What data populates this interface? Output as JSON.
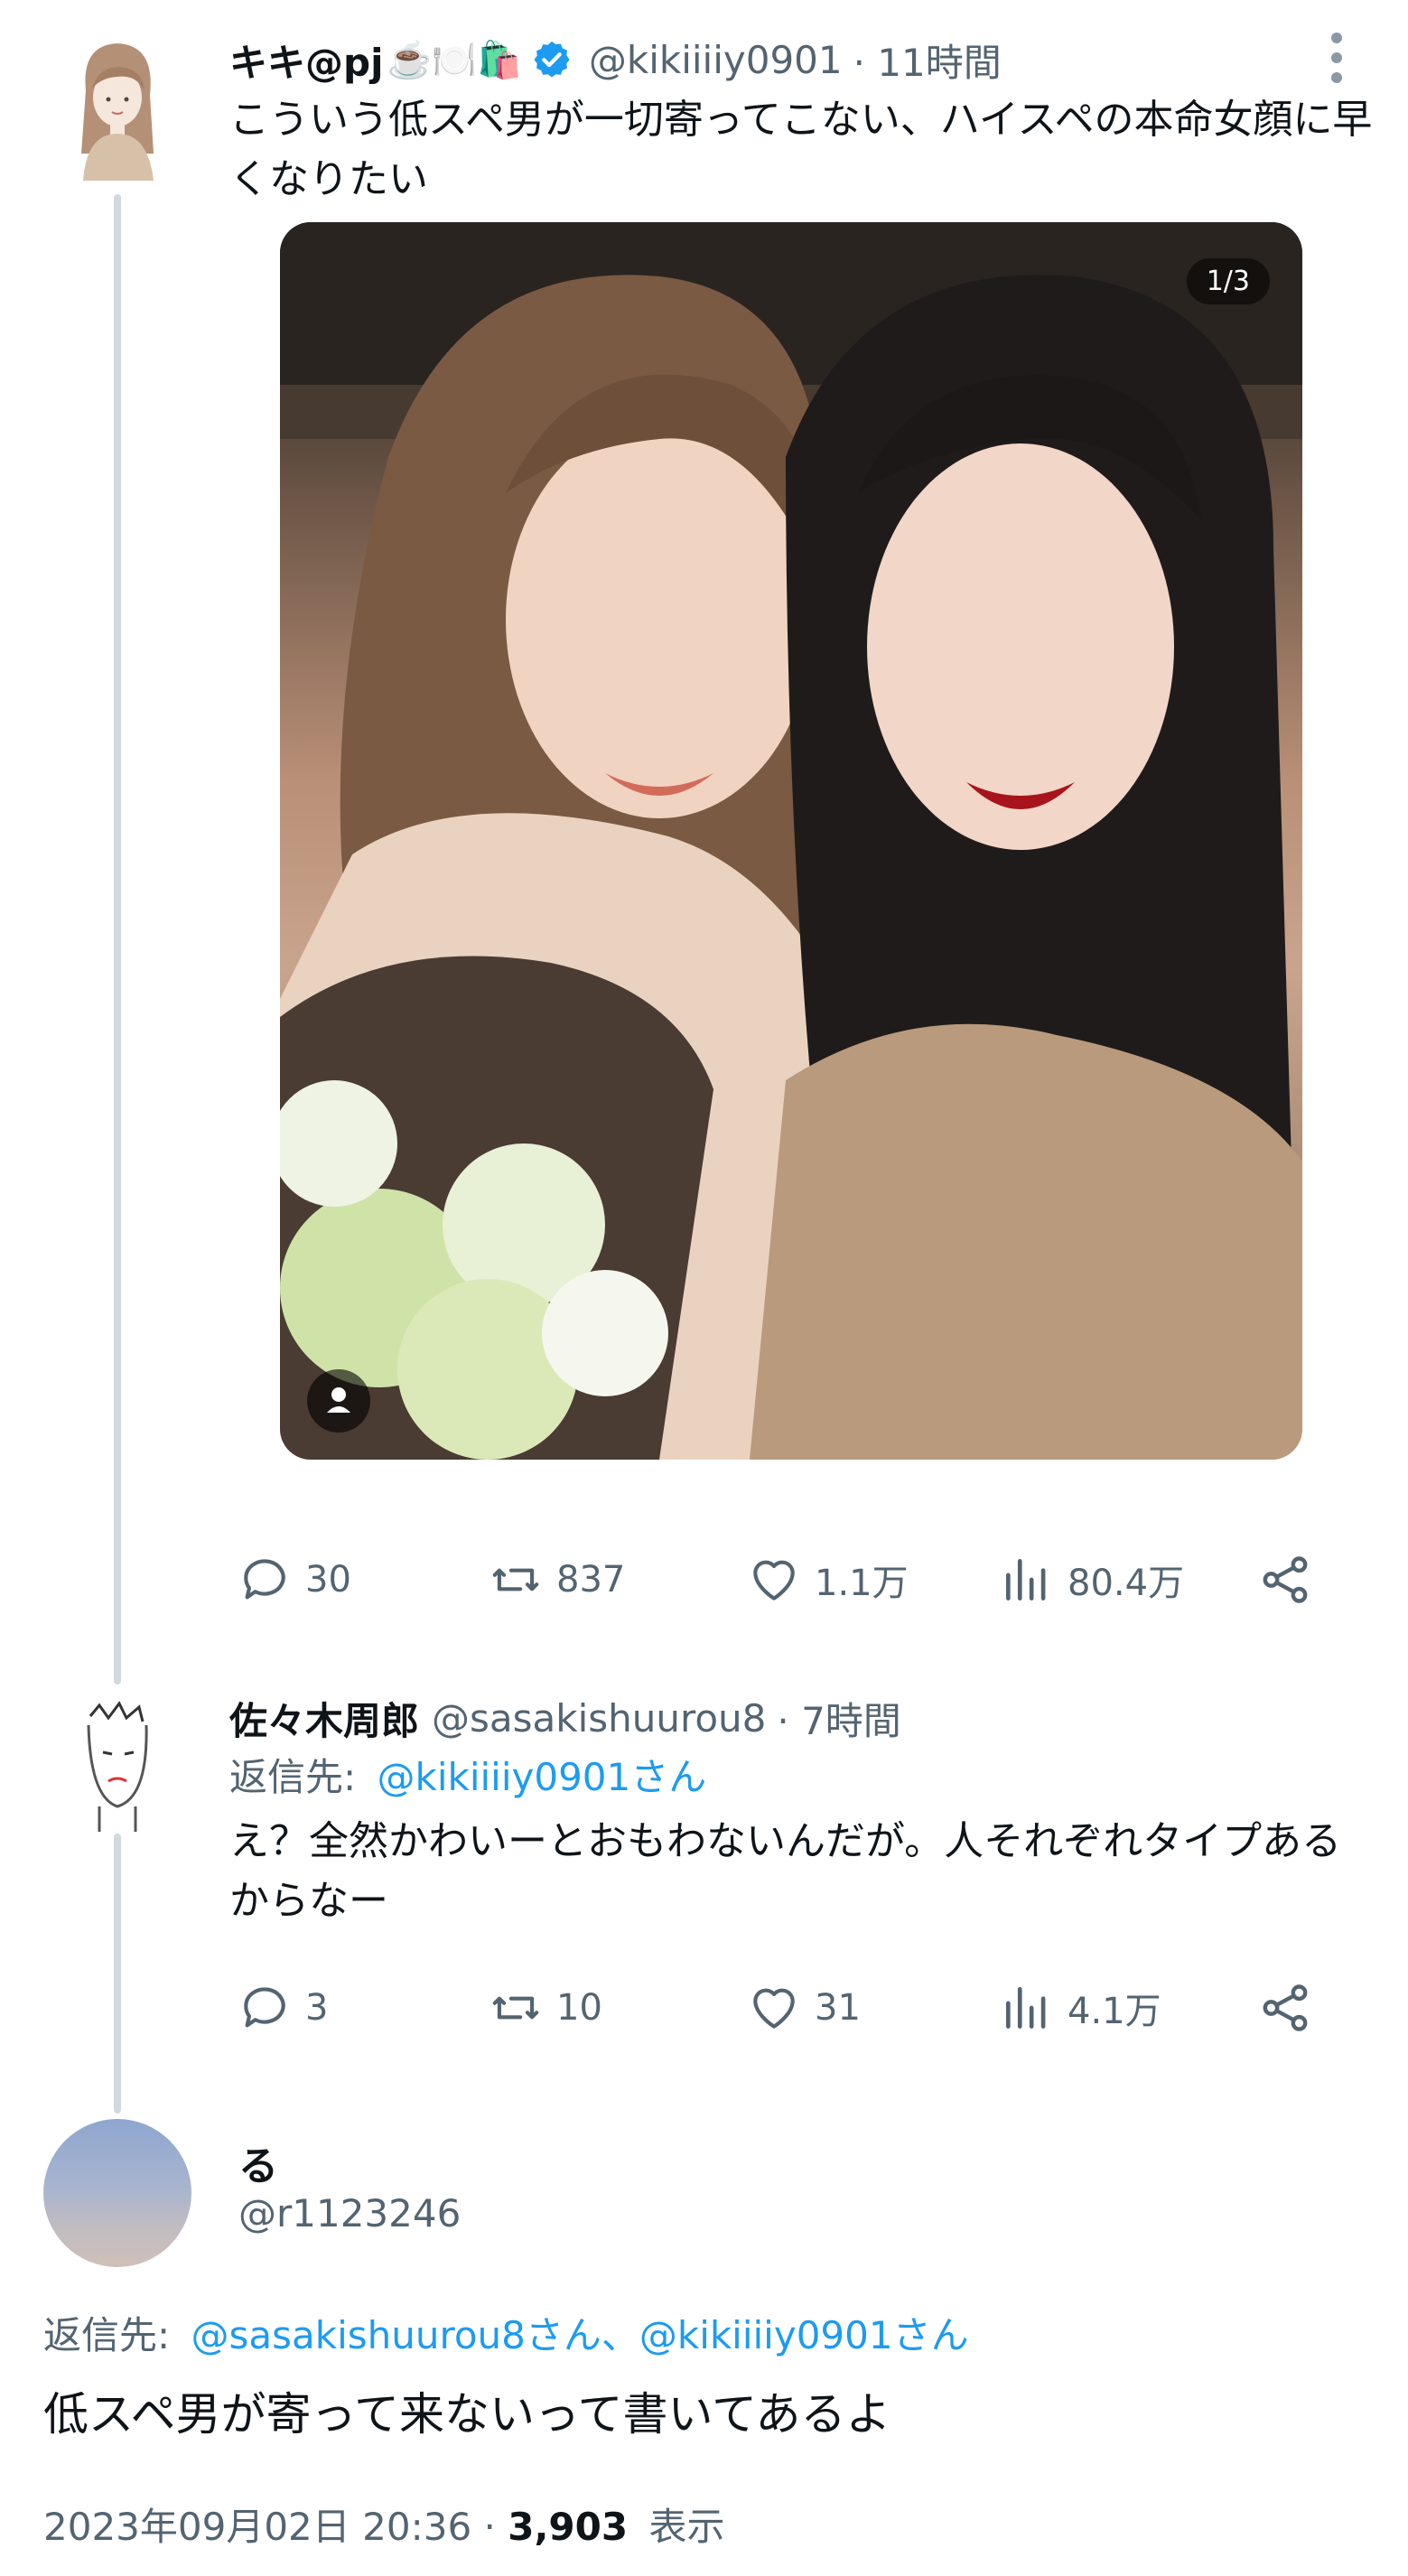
{
  "tweet1": {
    "name": "キキ@pj",
    "emoji": "☕️🍽️🛍️",
    "handle": "@kikiiiiy0901",
    "time": "· 11時間",
    "text": "こういう低スペ男が一切寄ってこない、ハイスペの本命女顔に早くなりたい",
    "media_counter": "1/3",
    "stats": {
      "replies": "30",
      "retweets": "837",
      "likes": "1.1万",
      "views": "80.4万"
    }
  },
  "tweet2": {
    "name": "佐々木周郎",
    "handle": "@sasakishuurou8",
    "time": "· 7時間",
    "reply_label": "返信先:",
    "reply_to": "@kikiiiiy0901さん",
    "text": "え？全然かわいーとおもわないんだが。人それぞれタイプあるからなー",
    "stats": {
      "replies": "3",
      "retweets": "10",
      "likes": "31",
      "views": "4.1万"
    }
  },
  "tweet3": {
    "name": "る",
    "handle": "@r1123246",
    "reply_label": "返信先:",
    "reply_to": "@sasakishuurou8さん、@kikiiiiy0901さん",
    "text": "低スペ男が寄って来ないって書いてあるよ",
    "timestamp": "2023年09月02日 20:36 · ",
    "views_count": "3,903",
    "views_label": "表示"
  },
  "icons": {
    "reply": "reply-icon",
    "retweet": "retweet-icon",
    "like": "heart-icon",
    "views": "views-icon",
    "share": "share-icon",
    "verified": "verified-badge-icon",
    "more": "more-icon"
  },
  "colors": {
    "link": "#1d9bf0",
    "muted": "#536471",
    "verified": "#1d9bf0",
    "thread": "#cfd9de"
  }
}
